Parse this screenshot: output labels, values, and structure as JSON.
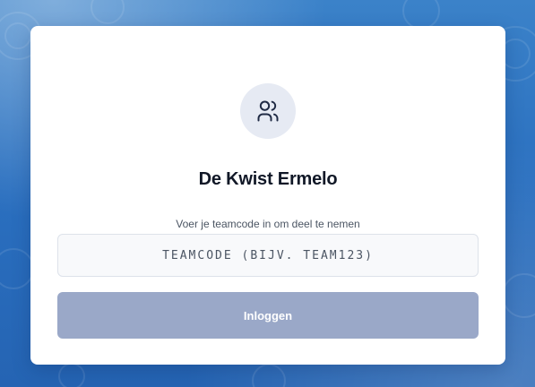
{
  "card": {
    "title": "De Kwist Ermelo",
    "subtitle": "Voer je teamcode in om deel te nemen",
    "icon": "users-icon"
  },
  "form": {
    "team_code": {
      "value": "",
      "placeholder": "TEAMCODE (BIJV. TEAM123)"
    },
    "login_label": "Inloggen"
  },
  "colors": {
    "background": "#2a6fbf",
    "card": "#ffffff",
    "icon_circle": "#e6eaf3",
    "title": "#111827",
    "button_disabled": "#9aa8c8",
    "button_text": "#ffffff"
  }
}
